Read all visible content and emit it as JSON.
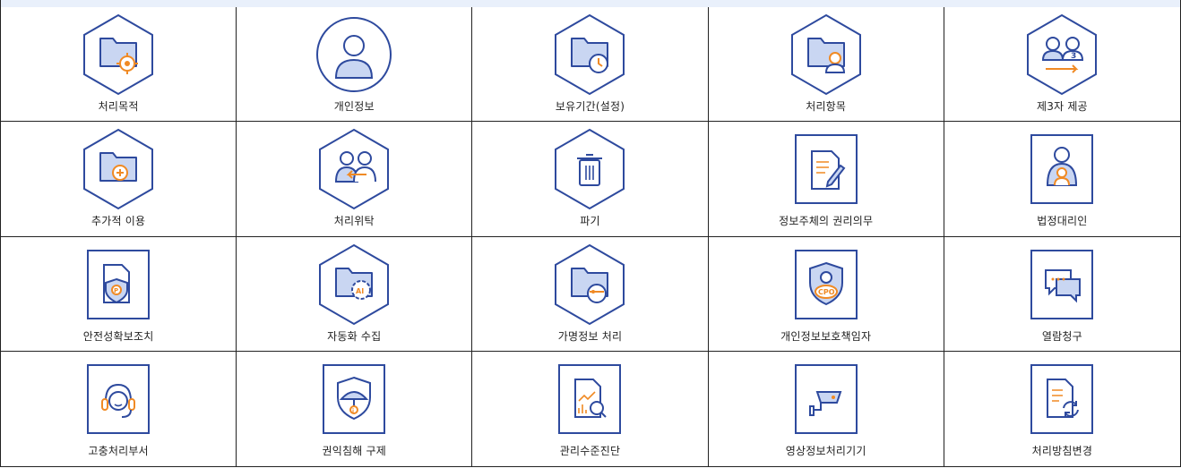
{
  "colors": {
    "blue": "#2e4a9e",
    "light_blue": "#c9d6f2",
    "orange": "#f08a24",
    "header_bg": "#e9f0fb"
  },
  "items": [
    {
      "label": "처리목적",
      "icon": "folder-target-icon",
      "frame": "hex"
    },
    {
      "label": "개인정보",
      "icon": "person-icon",
      "frame": "circle"
    },
    {
      "label": "보유기간(설정)",
      "icon": "folder-clock-icon",
      "frame": "hex"
    },
    {
      "label": "처리항목",
      "icon": "folder-person-icon",
      "frame": "hex"
    },
    {
      "label": "제3자 제공",
      "icon": "third-party-icon",
      "frame": "hex"
    },
    {
      "label": "추가적 이용",
      "icon": "folder-plus-icon",
      "frame": "hex"
    },
    {
      "label": "처리위탁",
      "icon": "delegation-icon",
      "frame": "hex"
    },
    {
      "label": "파기",
      "icon": "trash-icon",
      "frame": "hex"
    },
    {
      "label": "정보주체의 권리의무",
      "icon": "document-pen-icon",
      "frame": "square"
    },
    {
      "label": "법정대리인",
      "icon": "guardian-icon",
      "frame": "square"
    },
    {
      "label": "안전성확보조치",
      "icon": "document-shield-icon",
      "frame": "square"
    },
    {
      "label": "자동화 수집",
      "icon": "folder-ai-gear-icon",
      "frame": "hex"
    },
    {
      "label": "가명정보 처리",
      "icon": "folder-mask-icon",
      "frame": "hex"
    },
    {
      "label": "개인정보보호책임자",
      "icon": "cpo-shield-icon",
      "frame": "square"
    },
    {
      "label": "열람청구",
      "icon": "chat-bubbles-icon",
      "frame": "square"
    },
    {
      "label": "고충처리부서",
      "icon": "headset-icon",
      "frame": "square"
    },
    {
      "label": "권익침해 구제",
      "icon": "umbrella-shield-icon",
      "frame": "square"
    },
    {
      "label": "관리수준진단",
      "icon": "report-search-icon",
      "frame": "square"
    },
    {
      "label": "영상정보처리기기",
      "icon": "cctv-icon",
      "frame": "square"
    },
    {
      "label": "처리방침변경",
      "icon": "document-refresh-icon",
      "frame": "square"
    }
  ]
}
